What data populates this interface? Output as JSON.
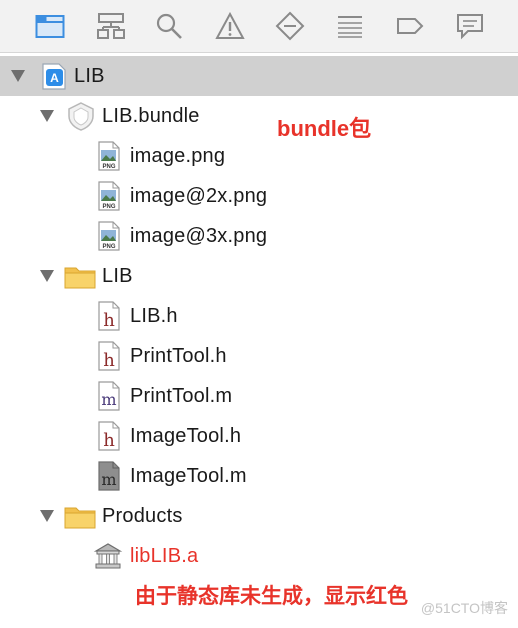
{
  "toolbar": {
    "icons": [
      "folder-icon",
      "hierarchy-icon",
      "search-icon",
      "warning-icon",
      "breakpoint-diamond-icon",
      "list-icon",
      "tag-icon",
      "comment-icon"
    ]
  },
  "tree": {
    "project": "LIB",
    "bundle": "LIB.bundle",
    "bundle_files": [
      "image.png",
      "image@2x.png",
      "image@3x.png"
    ],
    "group": "LIB",
    "group_files": [
      "LIB.h",
      "PrintTool.h",
      "PrintTool.m",
      "ImageTool.h",
      "ImageTool.m"
    ],
    "products_group": "Products",
    "product": "libLIB.a"
  },
  "annotations": {
    "bundle_note": "bundle包",
    "product_note": "由于静态库未生成，显示红色"
  },
  "png_badge": "PNG",
  "h_glyph": "h",
  "m_glyph": "m",
  "watermark": "@51CTO博客",
  "colors": {
    "annotation": "#e8332a",
    "toolbar_icon": "#8a8a8a",
    "toolbar_icon_active": "#3c8ee0",
    "selection": "#d0d0d0"
  }
}
